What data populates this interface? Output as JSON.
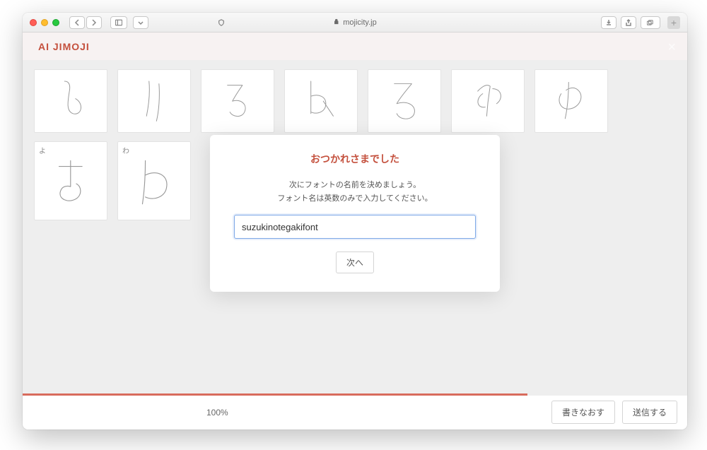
{
  "browser": {
    "url_host": "mojicity.jp"
  },
  "app": {
    "logo": "AI JIMOJI"
  },
  "cells_row1": [
    {
      "label": ""
    },
    {
      "label": ""
    },
    {
      "label": ""
    },
    {
      "label": ""
    },
    {
      "label": ""
    },
    {
      "label": ""
    },
    {
      "label": ""
    }
  ],
  "cells_row2": [
    {
      "label": "よ"
    },
    {
      "label": "わ"
    }
  ],
  "modal": {
    "title": "おつかれさまでした",
    "line1": "次にフォントの名前を決めましょう。",
    "line2": "フォント名は英数のみで入力してください。",
    "input_value": "suzukinotegakifont",
    "next_label": "次へ"
  },
  "footer": {
    "progress_percent": "100%",
    "redo_label": "書きなおす",
    "submit_label": "送信する"
  }
}
